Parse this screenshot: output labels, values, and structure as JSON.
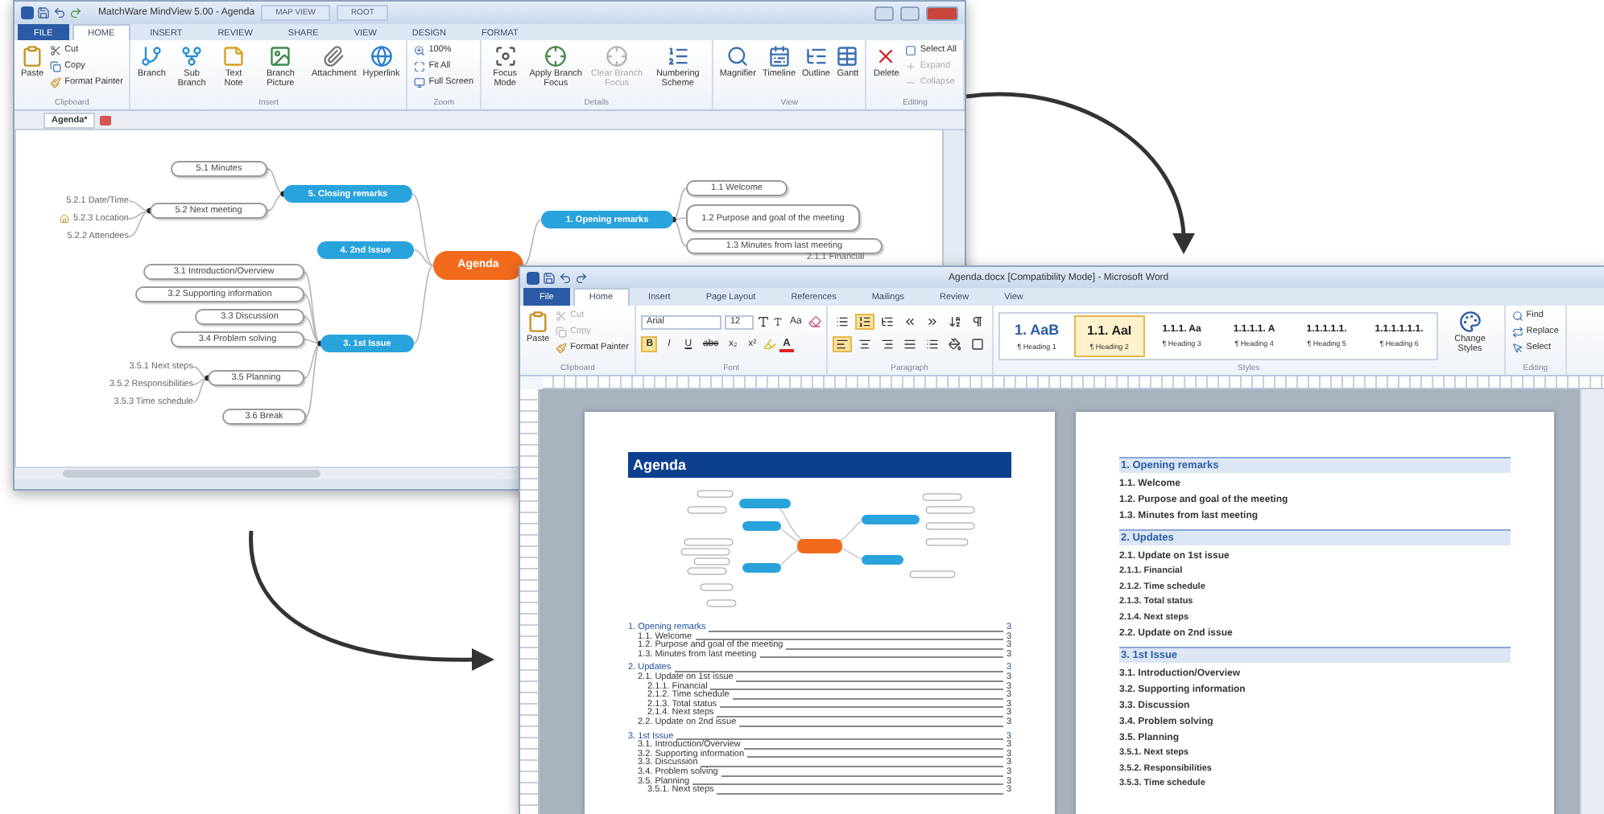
{
  "mindview": {
    "title": "MatchWare MindView 5.00 - Agenda",
    "context_tabs": [
      "MAP VIEW",
      "ROOT"
    ],
    "tabs": [
      {
        "label": "FILE",
        "kind": "file",
        "selected": false
      },
      {
        "label": "HOME",
        "kind": "tab",
        "selected": true
      },
      {
        "label": "INSERT",
        "kind": "tab",
        "selected": false
      },
      {
        "label": "REVIEW",
        "kind": "tab",
        "selected": false
      },
      {
        "label": "SHARE",
        "kind": "tab",
        "selected": false
      },
      {
        "label": "VIEW",
        "kind": "tab",
        "selected": false
      },
      {
        "label": "DESIGN",
        "kind": "tab",
        "selected": false
      },
      {
        "label": "FORMAT",
        "kind": "tab",
        "selected": false
      }
    ],
    "groups": [
      {
        "label": "Clipboard",
        "buttons": [
          {
            "label": "Paste",
            "kind": "large",
            "disabled": false
          },
          {
            "label": "Cut",
            "kind": "small",
            "disabled": false
          },
          {
            "label": "Copy",
            "kind": "small",
            "disabled": false
          },
          {
            "label": "Format Painter",
            "kind": "small",
            "disabled": false
          }
        ]
      },
      {
        "label": "Insert",
        "buttons": [
          {
            "label": "Branch",
            "kind": "large",
            "disabled": false
          },
          {
            "label": "Sub Branch",
            "kind": "large",
            "disabled": false
          },
          {
            "label": "Text Note",
            "kind": "large",
            "disabled": false
          },
          {
            "label": "Branch Picture",
            "kind": "large",
            "disabled": false
          },
          {
            "label": "Attachment",
            "kind": "large",
            "disabled": false
          },
          {
            "label": "Hyperlink",
            "kind": "large",
            "disabled": false
          }
        ]
      },
      {
        "label": "Zoom",
        "buttons": [
          {
            "label": "100%",
            "kind": "small",
            "disabled": false
          },
          {
            "label": "Fit All",
            "kind": "small",
            "disabled": false
          },
          {
            "label": "Full Screen",
            "kind": "small",
            "disabled": false
          }
        ]
      },
      {
        "label": "Details",
        "buttons": [
          {
            "label": "Focus Mode",
            "kind": "large",
            "disabled": false
          },
          {
            "label": "Apply Branch Focus",
            "kind": "large",
            "disabled": false
          },
          {
            "label": "Clear Branch Focus",
            "kind": "large",
            "disabled": true
          },
          {
            "label": "Numbering Scheme",
            "kind": "large",
            "disabled": false
          }
        ]
      },
      {
        "label": "View",
        "buttons": [
          {
            "label": "Magnifier",
            "kind": "large",
            "disabled": false
          },
          {
            "label": "Timeline",
            "kind": "large",
            "disabled": false
          },
          {
            "label": "Outline",
            "kind": "large",
            "disabled": false
          },
          {
            "label": "Gantt",
            "kind": "large",
            "disabled": false
          }
        ]
      },
      {
        "label": "Editing",
        "buttons": [
          {
            "label": "Delete",
            "kind": "large",
            "disabled": false
          },
          {
            "label": "Select All",
            "kind": "small",
            "disabled": false
          },
          {
            "label": "Expand",
            "kind": "small",
            "disabled": true
          },
          {
            "label": "Collapse",
            "kind": "small",
            "disabled": true
          }
        ]
      }
    ],
    "document_tab": "Agenda*",
    "mindmap": {
      "root": {
        "text": "Agenda",
        "children": [
          {
            "text": "5. Closing remarks",
            "children": [
              {
                "text": "5.1 Minutes"
              },
              {
                "text": "5.2 Next meeting",
                "children": [
                  {
                    "text": "5.2.1 Date/Time",
                    "marked": false
                  },
                  {
                    "text": "5.2.3 Location",
                    "marked": true
                  },
                  {
                    "text": "5.2.2 Attendees",
                    "marked": false
                  }
                ]
              }
            ]
          },
          {
            "text": "4. 2nd Issue"
          },
          {
            "text": "3. 1st Issue",
            "children": [
              {
                "text": "3.1 Introduction/Overview"
              },
              {
                "text": "3.2 Supporting information"
              },
              {
                "text": "3.3 Discussion"
              },
              {
                "text": "3.4 Problem solving"
              },
              {
                "text": "3.5 Planning",
                "children": [
                  {
                    "text": "3.5.1 Next steps",
                    "marked": false
                  },
                  {
                    "text": "3.5.2 Responsibilities",
                    "marked": false
                  },
                  {
                    "text": "3.5.3 Time schedule",
                    "marked": false
                  }
                ]
              },
              {
                "text": "3.6 Break"
              }
            ]
          },
          {
            "text": "1. Opening remarks",
            "children": [
              {
                "text": "1.1 Welcome"
              },
              {
                "text": "1.2 Purpose and goal of the meeting"
              },
              {
                "text": "1.3 Minutes from last meeting"
              }
            ]
          }
        ]
      },
      "partly_hidden_label": "2.1.1 Financial"
    }
  },
  "word": {
    "title": "Agenda.docx [Compatibility Mode] - Microsoft Word",
    "tabs": [
      {
        "label": "File",
        "kind": "file",
        "selected": false
      },
      {
        "label": "Home",
        "kind": "tab",
        "selected": true
      },
      {
        "label": "Insert",
        "kind": "tab",
        "selected": false
      },
      {
        "label": "Page Layout",
        "kind": "tab",
        "selected": false
      },
      {
        "label": "References",
        "kind": "tab",
        "selected": false
      },
      {
        "label": "Mailings",
        "kind": "tab",
        "selected": false
      },
      {
        "label": "Review",
        "kind": "tab",
        "selected": false
      },
      {
        "label": "View",
        "kind": "tab",
        "selected": false
      }
    ],
    "clipboard": {
      "label": "Clipboard",
      "buttons": [
        {
          "label": "Paste",
          "kind": "large",
          "disabled": false
        },
        {
          "label": "Cut",
          "kind": "small",
          "disabled": true
        },
        {
          "label": "Copy",
          "kind": "small",
          "disabled": true
        },
        {
          "label": "Format Painter",
          "kind": "small",
          "disabled": false
        }
      ]
    },
    "font": {
      "label": "Font",
      "font": "Arial",
      "size": "12",
      "case_button": "Aa",
      "format_buttons": [
        {
          "label": "B",
          "selected": true
        },
        {
          "label": "I",
          "selected": false
        },
        {
          "label": "U",
          "selected": false
        },
        {
          "label": "abc",
          "selected": false
        },
        {
          "label": "x₂",
          "selected": false
        },
        {
          "label": "x²",
          "selected": false
        }
      ],
      "color_button": "A"
    },
    "paragraph": {
      "label": "Paragraph",
      "buttons": [
        {
          "selected": false
        },
        {
          "selected": true
        },
        {
          "selected": false
        },
        {
          "selected": false
        },
        {
          "selected": false
        },
        {
          "selected": false
        },
        {
          "selected": false
        },
        {
          "selected": true
        },
        {
          "selected": false
        },
        {
          "selected": false
        },
        {
          "selected": false
        },
        {
          "selected": false
        },
        {
          "selected": false
        },
        {
          "selected": false
        }
      ]
    },
    "styles": {
      "label": "Styles",
      "items": [
        {
          "sample": "1. AaB",
          "label": "¶ Heading 1",
          "selected": false
        },
        {
          "sample": "1.1. AaI",
          "label": "¶ Heading 2",
          "selected": true
        },
        {
          "sample": "1.1.1. Aa",
          "label": "¶ Heading 3",
          "selected": false
        },
        {
          "sample": "1.1.1.1. A",
          "label": "¶ Heading 4",
          "selected": false
        },
        {
          "sample": "1.1.1.1.1.",
          "label": "¶ Heading 5",
          "selected": false
        },
        {
          "sample": "1.1.1.1.1.1.",
          "label": "¶ Heading 6",
          "selected": false
        }
      ],
      "change_styles": "Change Styles"
    },
    "editing": {
      "label": "Editing",
      "buttons": [
        {
          "label": "Find",
          "kind": "small",
          "disabled": false
        },
        {
          "label": "Replace",
          "kind": "small",
          "disabled": false
        },
        {
          "label": "Select",
          "kind": "small",
          "disabled": false
        }
      ]
    },
    "page1": {
      "banner": "Agenda",
      "toc": [
        {
          "text": "1. Opening remarks",
          "page": "3",
          "children": [
            {
              "text": "1.1. Welcome",
              "page": "3"
            },
            {
              "text": "1.2. Purpose and goal of the meeting",
              "page": "3"
            },
            {
              "text": "1.3. Minutes from last meeting",
              "page": "3"
            }
          ]
        },
        {
          "text": "2. Updates",
          "page": "3",
          "children": [
            {
              "text": "2.1. Update on 1st issue",
              "page": "3",
              "children": [
                {
                  "text": "2.1.1. Financial",
                  "page": "3"
                },
                {
                  "text": "2.1.2. Time schedule",
                  "page": "3"
                },
                {
                  "text": "2.1.3. Total status",
                  "page": "3"
                },
                {
                  "text": "2.1.4. Next steps",
                  "page": "3"
                }
              ]
            },
            {
              "text": "2.2. Update on 2nd issue",
              "page": "3"
            }
          ]
        },
        {
          "text": "3. 1st Issue",
          "page": "3",
          "children": [
            {
              "text": "3.1. Introduction/Overview",
              "page": "3"
            },
            {
              "text": "3.2. Supporting information",
              "page": "3"
            },
            {
              "text": "3.3. Discussion",
              "page": "3"
            },
            {
              "text": "3.4. Problem solving",
              "page": "3"
            },
            {
              "text": "3.5. Planning",
              "page": "3",
              "children": [
                {
                  "text": "3.5.1. Next steps",
                  "page": "3"
                }
              ]
            }
          ]
        }
      ]
    },
    "page2": [
      {
        "text": "1. Opening remarks",
        "kind": "heading"
      },
      {
        "text": "1.1. Welcome",
        "kind": "item"
      },
      {
        "text": "1.2. Purpose and goal of the meeting",
        "kind": "item"
      },
      {
        "text": "1.3. Minutes from last meeting",
        "kind": "item"
      },
      {
        "text": "2. Updates",
        "kind": "heading"
      },
      {
        "text": "2.1. Update on 1st issue",
        "kind": "item"
      },
      {
        "text": "2.1.1. Financial",
        "kind": "subitem"
      },
      {
        "text": "2.1.2. Time schedule",
        "kind": "subitem"
      },
      {
        "text": "2.1.3. Total status",
        "kind": "subitem"
      },
      {
        "text": "2.1.4. Next steps",
        "kind": "subitem"
      },
      {
        "text": "2.2. Update on 2nd issue",
        "kind": "item"
      },
      {
        "text": "3. 1st Issue",
        "kind": "heading"
      },
      {
        "text": "3.1. Introduction/Overview",
        "kind": "item"
      },
      {
        "text": "3.2. Supporting information",
        "kind": "item"
      },
      {
        "text": "3.3. Discussion",
        "kind": "item"
      },
      {
        "text": "3.4. Problem solving",
        "kind": "item"
      },
      {
        "text": "3.5. Planning",
        "kind": "item"
      },
      {
        "text": "3.5.1. Next steps",
        "kind": "subitem"
      },
      {
        "text": "3.5.2. Responsibilities",
        "kind": "subitem"
      },
      {
        "text": "3.5.3. Time schedule",
        "kind": "subitem"
      }
    ]
  }
}
